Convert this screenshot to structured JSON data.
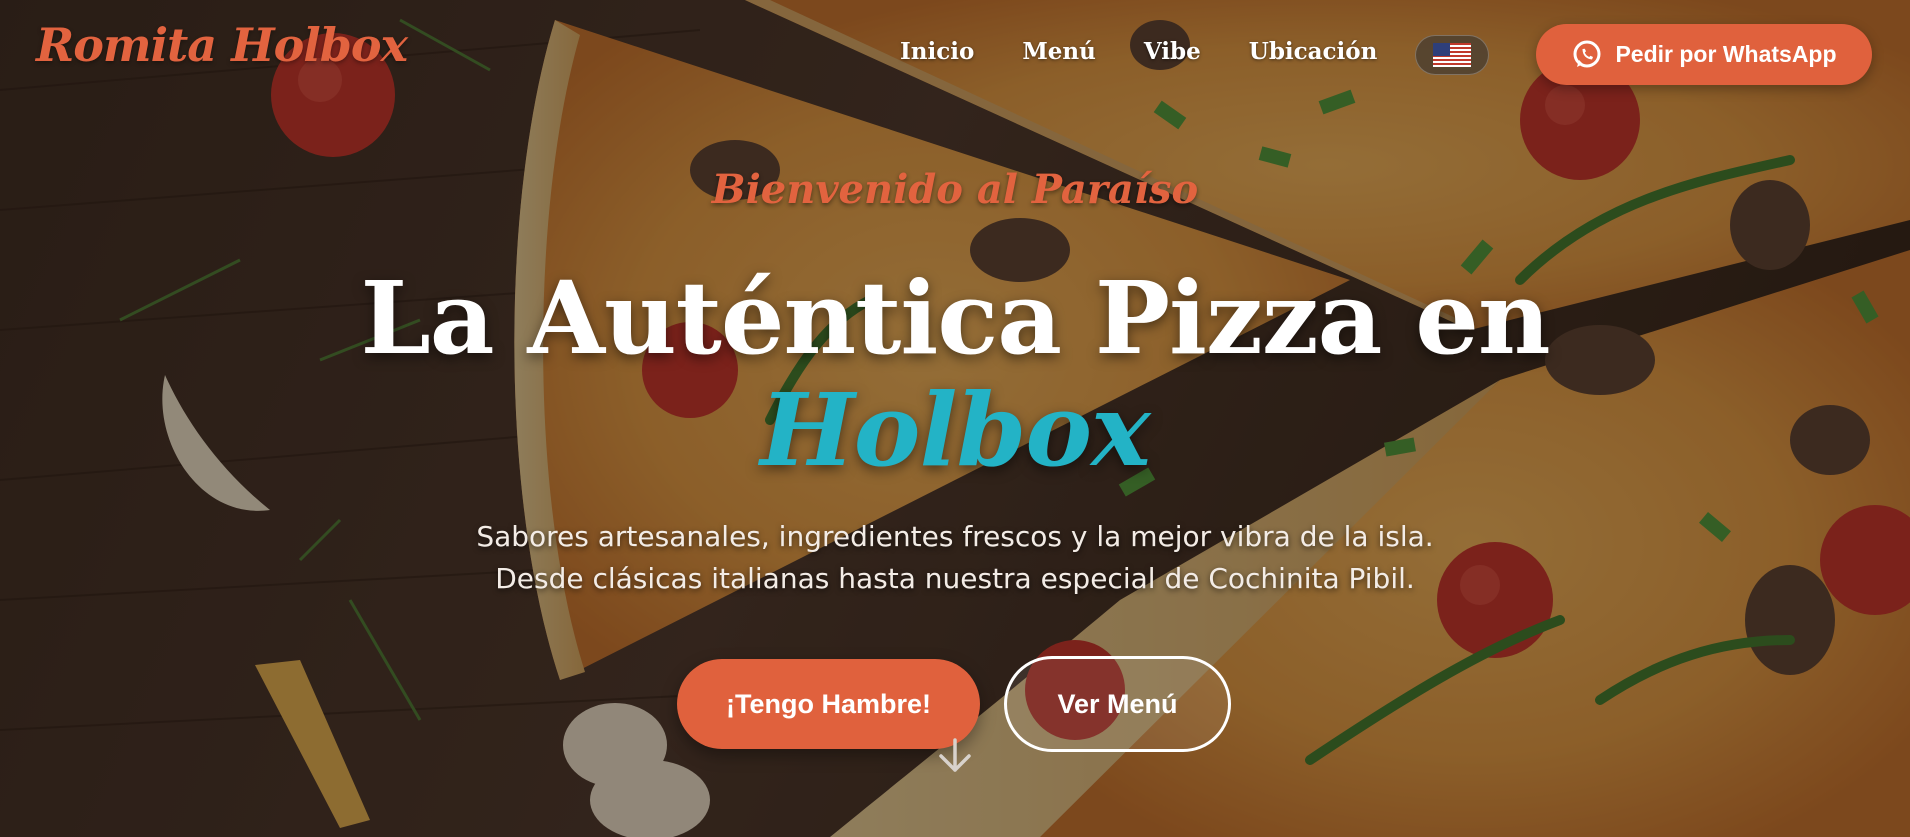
{
  "header": {
    "logo": "Romita Holbox",
    "nav": [
      {
        "label": "Inicio"
      },
      {
        "label": "Menú"
      },
      {
        "label": "Vibe"
      },
      {
        "label": "Ubicación"
      }
    ],
    "language_flag": "us-flag-icon",
    "whatsapp_button": {
      "icon": "whatsapp-icon",
      "label": "Pedir por WhatsApp"
    }
  },
  "hero": {
    "kicker": "Bienvenido al Paraíso",
    "headline_line1": "La Auténtica Pizza en",
    "headline_accent": "Holbox",
    "subtitle_line1": "Sabores artesanales, ingredientes frescos y la mejor vibra de la isla.",
    "subtitle_line2": "Desde clásicas italianas hasta nuestra especial de Cochinita Pibil.",
    "cta_primary": "¡Tengo Hambre!",
    "cta_secondary": "Ver Menú",
    "scroll_icon": "arrow-down-icon"
  },
  "colors": {
    "accent": "#e0613d",
    "highlight": "#23b3c6",
    "text": "#ffffff"
  }
}
